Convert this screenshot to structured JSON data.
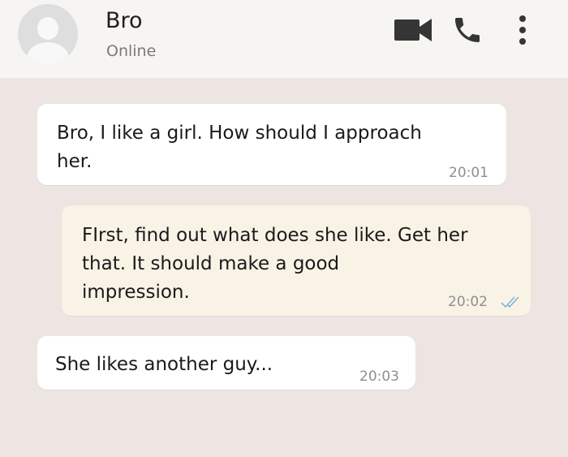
{
  "header": {
    "contact_name": "Bro",
    "status": "Online",
    "icons": [
      "avatar-icon",
      "video-call-icon",
      "phone-call-icon",
      "more-options-icon"
    ]
  },
  "messages": [
    {
      "direction": "incoming",
      "text": "Bro, I like a girl. How should I approach\nher.",
      "time": "20:01"
    },
    {
      "direction": "outgoing",
      "text": "FIrst, find out what does she like. Get her\nthat. It should make a good\nimpression.",
      "time": "20:02",
      "read": true
    },
    {
      "direction": "incoming",
      "text": "She likes another guy...",
      "time": "20:03"
    }
  ],
  "colors": {
    "chat_background": "#ede5e2",
    "header_background": "#f7f5f2",
    "incoming_bubble": "#ffffff",
    "outgoing_bubble": "#f9f3e6",
    "read_ticks": "#7fb4d6",
    "icon_color": "#353535"
  }
}
